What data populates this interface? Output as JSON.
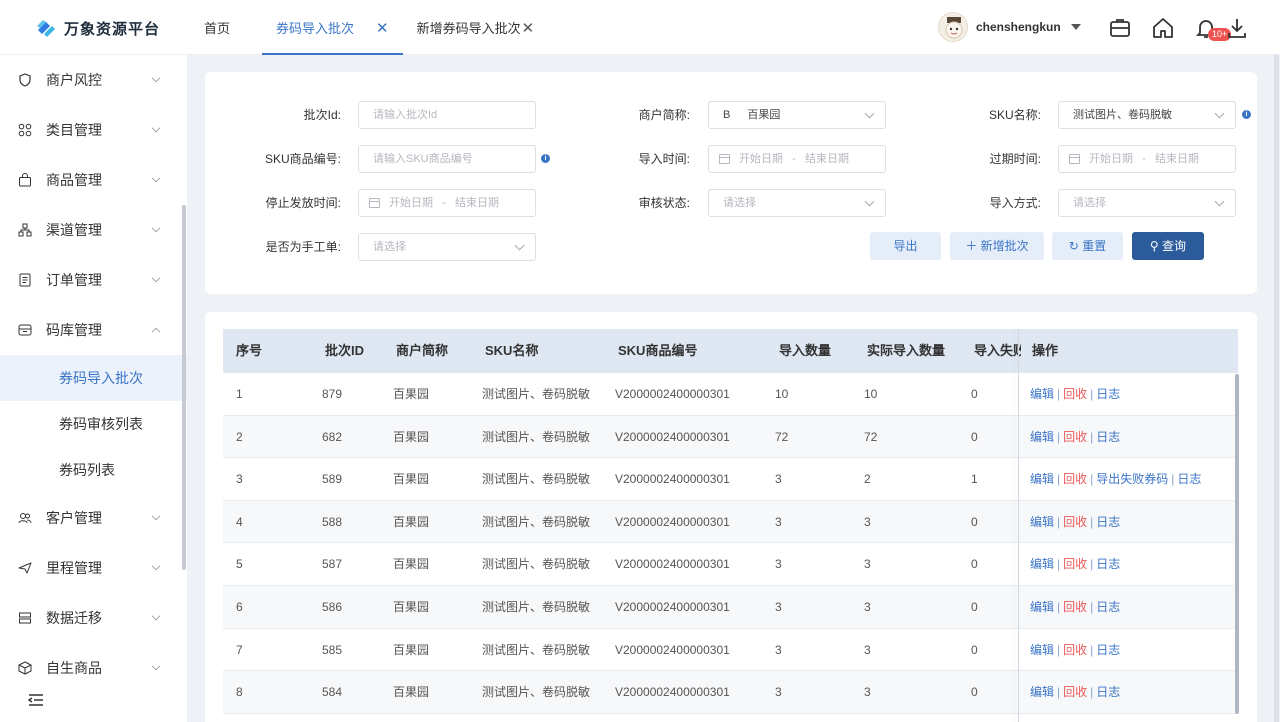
{
  "app": {
    "name": "万象资源平台"
  },
  "header": {
    "tabs": [
      {
        "label": "首页"
      },
      {
        "label": "券码导入批次",
        "close": "✕"
      },
      {
        "label": "新增券码导入批次",
        "close": "✕"
      }
    ],
    "user": {
      "name": "chenshengkun"
    },
    "notification_badge": "10+"
  },
  "sidebar": {
    "items": [
      {
        "label": "商户风控",
        "icon": "shield-icon"
      },
      {
        "label": "类目管理",
        "icon": "grid-icon"
      },
      {
        "label": "商品管理",
        "icon": "bag-icon"
      },
      {
        "label": "渠道管理",
        "icon": "network-icon"
      },
      {
        "label": "订单管理",
        "icon": "document-icon"
      },
      {
        "label": "码库管理",
        "icon": "archive-icon",
        "expanded": true,
        "children": [
          {
            "label": "券码导入批次",
            "active": true
          },
          {
            "label": "券码审核列表"
          },
          {
            "label": "券码列表"
          }
        ]
      },
      {
        "label": "客户管理",
        "icon": "users-icon"
      },
      {
        "label": "里程管理",
        "icon": "plane-icon"
      },
      {
        "label": "数据迁移",
        "icon": "database-icon"
      },
      {
        "label": "自生商品",
        "icon": "box-icon"
      }
    ]
  },
  "filters": {
    "batch_id": {
      "label": "批次Id:",
      "placeholder": "请输入批次Id"
    },
    "merchant": {
      "label": "商户简称:",
      "prefix": "B",
      "value": "百果园"
    },
    "sku_name": {
      "label": "SKU名称:",
      "value": "测试图片、卷码脱敏"
    },
    "sku_code": {
      "label": "SKU商品编号:",
      "placeholder": "请输入SKU商品编号"
    },
    "import_time": {
      "label": "导入时间:",
      "start": "开始日期",
      "sep": "-",
      "end": "结束日期"
    },
    "expire_time": {
      "label": "过期时间:",
      "start": "开始日期",
      "sep": "-",
      "end": "结束日期"
    },
    "stop_time": {
      "label": "停止发放时间:",
      "start": "开始日期",
      "sep": "-",
      "end": "结束日期"
    },
    "audit_status": {
      "label": "审核状态:",
      "placeholder": "请选择"
    },
    "import_method": {
      "label": "导入方式:",
      "placeholder": "请选择"
    },
    "manual": {
      "label": "是否为手工单:",
      "placeholder": "请选择"
    },
    "info": "i",
    "buttons": {
      "export": "导出",
      "add": "新增批次",
      "reset": "重置",
      "query": "查询"
    }
  },
  "table": {
    "columns": [
      "序号",
      "批次ID",
      "商户简称",
      "SKU名称",
      "SKU商品编号",
      "导入数量",
      "实际导入数量",
      "导入失败",
      "操作"
    ],
    "ops": {
      "edit": "编辑",
      "recycle": "回收",
      "export_failed": "导出失败券码",
      "log": "日志",
      "sep": "|"
    },
    "rows": [
      {
        "no": "1",
        "id": "879",
        "merchant": "百果园",
        "sku": "测试图片、卷码脱敏",
        "code": "V2000002400000301",
        "qty": "10",
        "actual": "10",
        "fail": "0",
        "export_failed": false
      },
      {
        "no": "2",
        "id": "682",
        "merchant": "百果园",
        "sku": "测试图片、卷码脱敏",
        "code": "V2000002400000301",
        "qty": "72",
        "actual": "72",
        "fail": "0",
        "export_failed": false
      },
      {
        "no": "3",
        "id": "589",
        "merchant": "百果园",
        "sku": "测试图片、卷码脱敏",
        "code": "V2000002400000301",
        "qty": "3",
        "actual": "2",
        "fail": "1",
        "export_failed": true
      },
      {
        "no": "4",
        "id": "588",
        "merchant": "百果园",
        "sku": "测试图片、卷码脱敏",
        "code": "V2000002400000301",
        "qty": "3",
        "actual": "3",
        "fail": "0",
        "export_failed": false
      },
      {
        "no": "5",
        "id": "587",
        "merchant": "百果园",
        "sku": "测试图片、卷码脱敏",
        "code": "V2000002400000301",
        "qty": "3",
        "actual": "3",
        "fail": "0",
        "export_failed": false
      },
      {
        "no": "6",
        "id": "586",
        "merchant": "百果园",
        "sku": "测试图片、卷码脱敏",
        "code": "V2000002400000301",
        "qty": "3",
        "actual": "3",
        "fail": "0",
        "export_failed": false
      },
      {
        "no": "7",
        "id": "585",
        "merchant": "百果园",
        "sku": "测试图片、卷码脱敏",
        "code": "V2000002400000301",
        "qty": "3",
        "actual": "3",
        "fail": "0",
        "export_failed": false
      },
      {
        "no": "8",
        "id": "584",
        "merchant": "百果园",
        "sku": "测试图片、卷码脱敏",
        "code": "V2000002400000301",
        "qty": "3",
        "actual": "3",
        "fail": "0",
        "export_failed": false
      }
    ]
  }
}
